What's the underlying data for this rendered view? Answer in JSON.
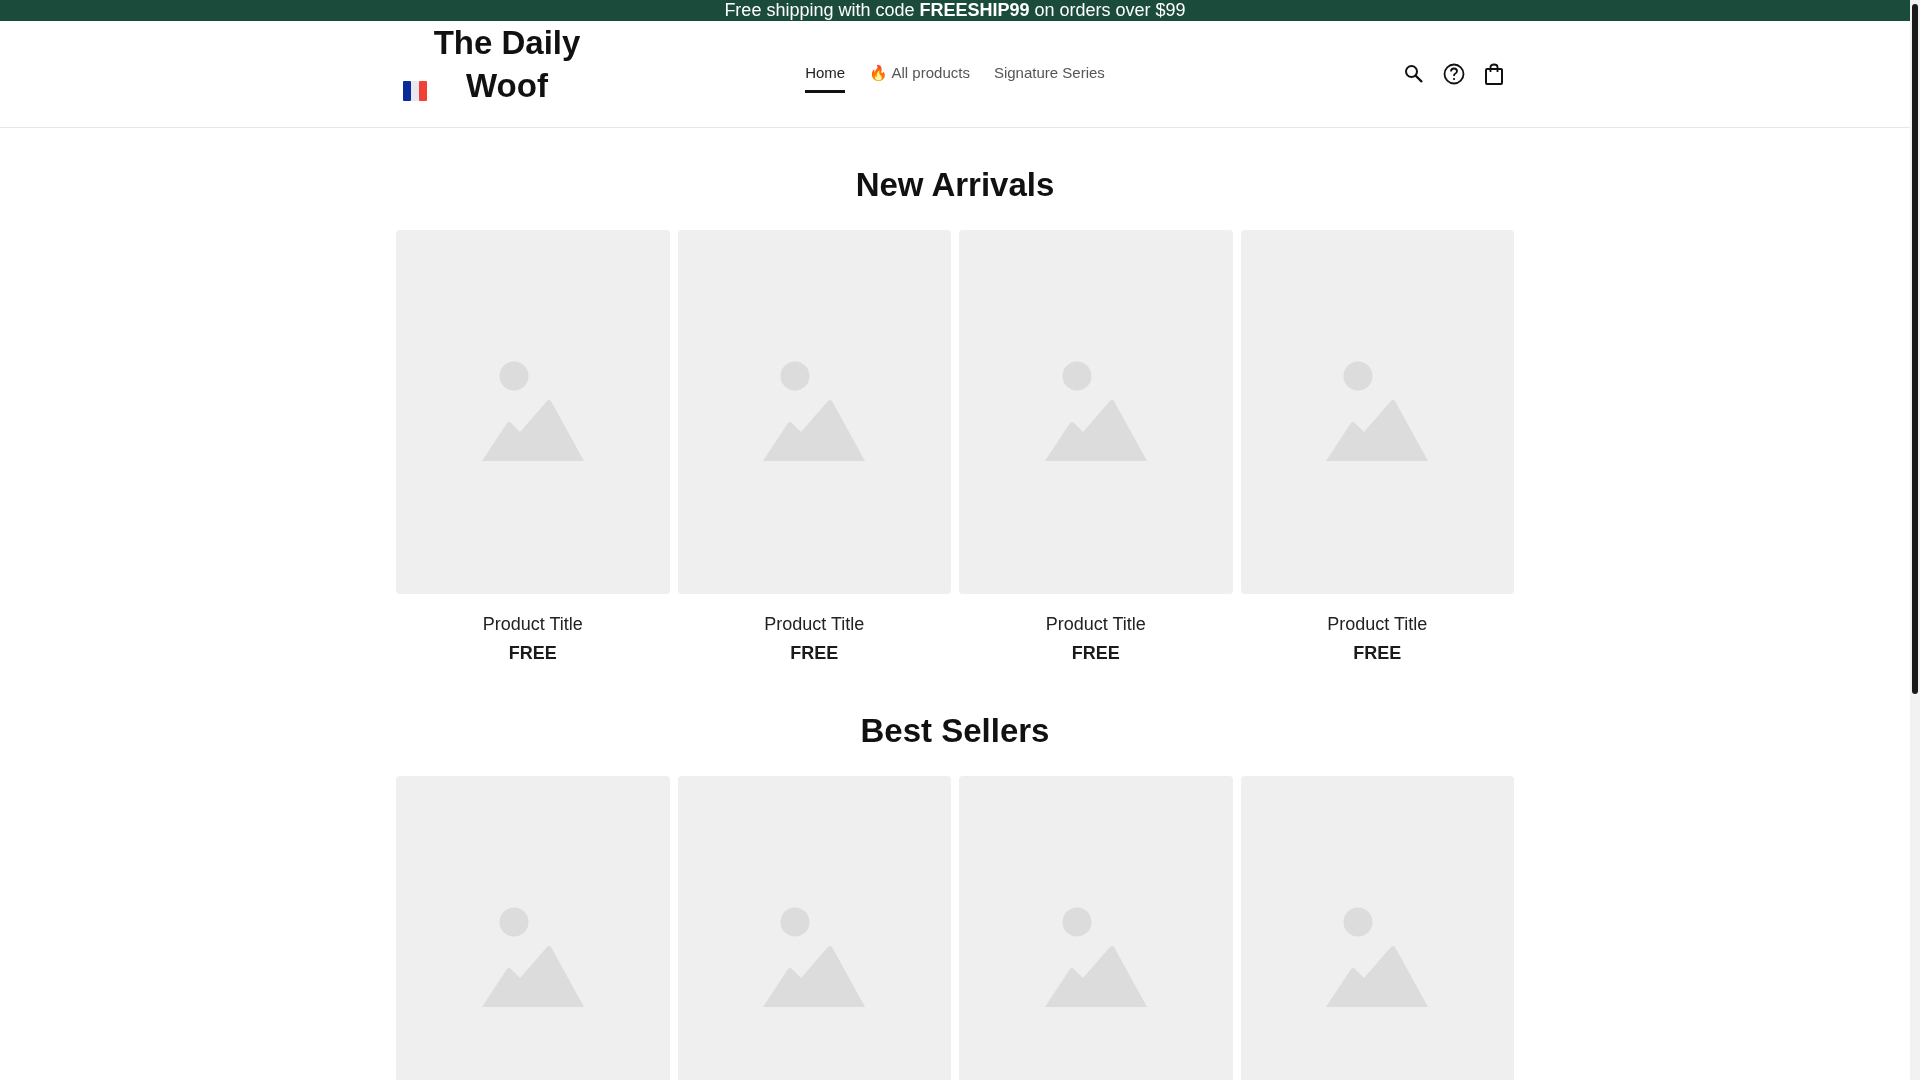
{
  "announcement": {
    "text": "Free shipping with code **FREESHIP99** on orders over $99"
  },
  "header": {
    "logo": "The Daily Woof",
    "nav": [
      {
        "label": "Home",
        "selected": true
      },
      {
        "label": "🔥 All products",
        "selected": false
      },
      {
        "label": "Signature Series",
        "selected": false
      }
    ]
  },
  "sections": [
    {
      "title": "New Arrivals",
      "products": [
        {
          "kind": "picture",
          "title": "Product Title",
          "price": "FREE"
        },
        {
          "kind": "picture",
          "title": "Product Title",
          "price": "FREE"
        },
        {
          "kind": "picture",
          "title": "Product Title",
          "price": "FREE"
        },
        {
          "kind": "picture",
          "title": "Product Title",
          "price": "FREE"
        }
      ]
    },
    {
      "title": "Best Sellers"
    }
  ]
}
